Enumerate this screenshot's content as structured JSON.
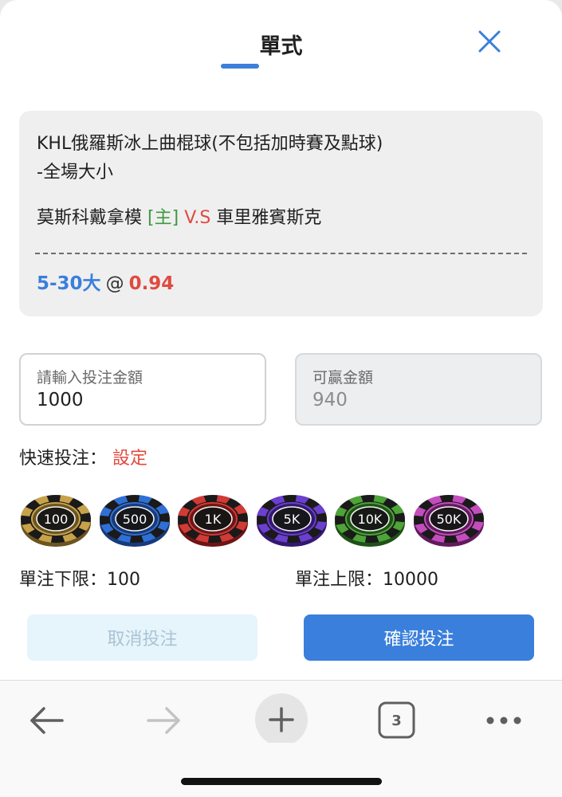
{
  "header": {
    "title": "單式"
  },
  "match": {
    "league": "KHL俄羅斯冰上曲棍球(不包括加時賽及點球)",
    "market": "-全場大小",
    "home_team": "莫斯科戴拿模",
    "home_tag": "[主]",
    "vs": "V.S",
    "away_team": "車里雅賓斯克",
    "selection": "5-30大",
    "at": "@",
    "odds": "0.94"
  },
  "stake": {
    "label": "請輸入投注金額",
    "value": "1000"
  },
  "win": {
    "label": "可贏金額",
    "value": "940"
  },
  "quick": {
    "label": "快速投注：",
    "setting": "設定"
  },
  "chips": [
    {
      "label": "100",
      "color": "#c7a24a",
      "dark": "#6b5420",
      "icon": "chip-100-icon"
    },
    {
      "label": "500",
      "color": "#2f6fd6",
      "dark": "#173a7a",
      "icon": "chip-500-icon"
    },
    {
      "label": "1K",
      "color": "#d23a35",
      "dark": "#6e1515",
      "icon": "chip-1k-icon"
    },
    {
      "label": "5K",
      "color": "#6b3fcf",
      "dark": "#33196e",
      "icon": "chip-5k-icon"
    },
    {
      "label": "10K",
      "color": "#4ea339",
      "dark": "#1f5216",
      "icon": "chip-10k-icon"
    },
    {
      "label": "50K",
      "color": "#c44dbd",
      "dark": "#621a5e",
      "icon": "chip-50k-icon"
    }
  ],
  "limits": {
    "min": "單注下限：100",
    "max": "單注上限：10000"
  },
  "buttons": {
    "cancel": "取消投注",
    "confirm": "確認投注"
  },
  "toolbar": {
    "tab_count": "3",
    "icons": [
      "back-arrow-icon",
      "forward-arrow-icon",
      "plus-icon",
      "tabs-icon",
      "more-icon"
    ]
  },
  "colors": {
    "accent": "#3a7fdb",
    "odds_red": "#e04a3f",
    "home_green": "#3d9a3d",
    "cancel_bg": "#e6f4fb",
    "cancel_text": "#a9c4d6",
    "disabled_gray": "#c3c3c3"
  }
}
